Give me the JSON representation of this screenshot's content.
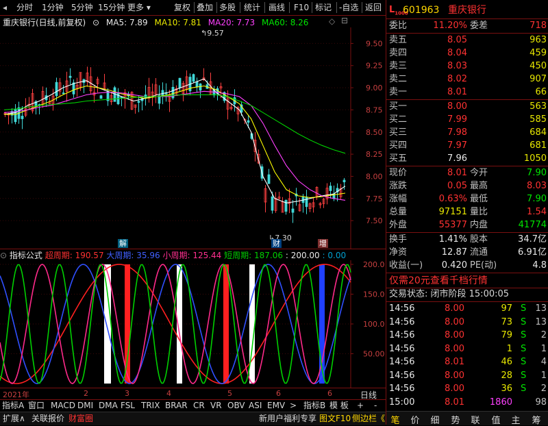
{
  "toolbar": {
    "items": [
      "分时",
      "1分钟",
      "5分钟",
      "15分钟",
      "更多"
    ],
    "items_right": [
      "复权",
      "叠加",
      "多股",
      "统计",
      "画线",
      "F10",
      "标记",
      "-自选",
      "返回"
    ]
  },
  "chart": {
    "title": "重庆银行(日线,前复权)",
    "ma5": "MA5: 7.89",
    "ma10": "MA10: 7.81",
    "ma20": "MA20: 7.73",
    "ma60": "MA60: 8.26",
    "yaxis": [
      "9.50",
      "9.25",
      "9.00",
      "8.75",
      "8.50",
      "8.25",
      "8.00",
      "7.75",
      "7.50"
    ],
    "high_mark": "9.57",
    "low_mark": "7.30",
    "badges": [
      "解",
      "财",
      "增"
    ]
  },
  "chart_data": {
    "type": "line",
    "title": "重庆银行(日线,前复权)",
    "xlabel": "",
    "ylabel": "",
    "ylim": [
      7.3,
      9.6
    ],
    "x": [
      1,
      2,
      3,
      4,
      5,
      6,
      7,
      8,
      9,
      10,
      11,
      12,
      13,
      14,
      15,
      16,
      17,
      18,
      19,
      20,
      21,
      22,
      23,
      24,
      25,
      26,
      27,
      28,
      29,
      30
    ],
    "series": [
      {
        "name": "MA5",
        "values": [
          8.7,
          8.72,
          8.8,
          8.85,
          8.92,
          9.0,
          9.05,
          9.08,
          9.0,
          8.95,
          8.9,
          8.85,
          8.88,
          8.92,
          8.95,
          9.0,
          9.05,
          9.1,
          8.95,
          8.85,
          8.75,
          8.5,
          8.0,
          7.75,
          7.7,
          7.72,
          7.75,
          7.78,
          7.8,
          7.89
        ]
      },
      {
        "name": "MA10",
        "values": [
          8.7,
          8.7,
          8.75,
          8.8,
          8.85,
          8.92,
          8.98,
          9.02,
          9.0,
          8.97,
          8.93,
          8.9,
          8.88,
          8.9,
          8.92,
          8.96,
          9.0,
          9.02,
          8.98,
          8.9,
          8.82,
          8.65,
          8.35,
          8.05,
          7.85,
          7.78,
          7.76,
          7.77,
          7.79,
          7.81
        ]
      },
      {
        "name": "MA20",
        "values": [
          8.72,
          8.73,
          8.75,
          8.78,
          8.8,
          8.84,
          8.88,
          8.92,
          8.94,
          8.95,
          8.94,
          8.92,
          8.9,
          8.9,
          8.9,
          8.92,
          8.94,
          8.96,
          8.95,
          8.93,
          8.9,
          8.8,
          8.6,
          8.35,
          8.12,
          7.95,
          7.85,
          7.78,
          7.75,
          7.73
        ]
      },
      {
        "name": "MA60",
        "values": [
          8.75,
          8.76,
          8.78,
          8.8,
          8.81,
          8.82,
          8.83,
          8.85,
          8.86,
          8.87,
          8.88,
          8.89,
          8.9,
          8.9,
          8.91,
          8.92,
          8.92,
          8.92,
          8.92,
          8.9,
          8.85,
          8.8,
          8.72,
          8.64,
          8.56,
          8.48,
          8.41,
          8.35,
          8.3,
          8.26
        ]
      }
    ]
  },
  "indicator": {
    "label": "指标公式",
    "super": "超周期: 190.57",
    "big": "大周期: 35.96",
    "small": "小周期: 125.44",
    "short": "短周期: 187.06",
    "v200": ": 200.00",
    "v0": ": 0.00",
    "yaxis": [
      "200.0",
      "150.0",
      "100.0",
      "50.00"
    ]
  },
  "timeline": {
    "year": "2021年",
    "months": [
      "2",
      "3",
      "4",
      "5",
      "6"
    ],
    "period": "日线"
  },
  "bottom_tabs": [
    "指标A",
    "窗口",
    "MACD",
    "DMI",
    "DMA",
    "FSL",
    "TRIX",
    "BRAR",
    "CR",
    "VR",
    "OBV",
    "ASI",
    "EMV",
    ">",
    "指标B",
    "模 板",
    "+",
    "-"
  ],
  "status": {
    "left": [
      "扩展∧",
      "关联报价",
      "财富圈"
    ],
    "right": [
      "新用户福利专享",
      "图文F10",
      "侧边栏《"
    ]
  },
  "quote": {
    "code": "601963",
    "name": "重庆银行",
    "weibi_label": "委比",
    "weibi": "11.20%",
    "weicha_label": "委差",
    "weicha": "718",
    "asks": [
      {
        "label": "卖五",
        "price": "8.05",
        "vol": "963"
      },
      {
        "label": "卖四",
        "price": "8.04",
        "vol": "459"
      },
      {
        "label": "卖三",
        "price": "8.03",
        "vol": "450"
      },
      {
        "label": "卖二",
        "price": "8.02",
        "vol": "907"
      },
      {
        "label": "卖一",
        "price": "8.01",
        "vol": "66"
      }
    ],
    "bids": [
      {
        "label": "买一",
        "price": "8.00",
        "vol": "563"
      },
      {
        "label": "买二",
        "price": "7.99",
        "vol": "585"
      },
      {
        "label": "买三",
        "price": "7.98",
        "vol": "684"
      },
      {
        "label": "买四",
        "price": "7.97",
        "vol": "681"
      },
      {
        "label": "买五",
        "price": "7.96",
        "vol": "1050"
      }
    ],
    "stats": [
      {
        "l1": "现价",
        "v1": "8.01",
        "l2": "今开",
        "v2": "7.90"
      },
      {
        "l1": "涨跌",
        "v1": "0.05",
        "l2": "最高",
        "v2": "8.03"
      },
      {
        "l1": "涨幅",
        "v1": "0.63%",
        "l2": "最低",
        "v2": "7.90"
      },
      {
        "l1": "总量",
        "v1": "97151",
        "l2": "量比",
        "v2": "1.54"
      },
      {
        "l1": "外盘",
        "v1": "55377",
        "l2": "内盘",
        "v2": "41774"
      }
    ],
    "stats2": [
      {
        "l1": "换手",
        "v1": "1.41%",
        "l2": "股本",
        "v2": "34.7亿"
      },
      {
        "l1": "净资",
        "v1": "12.87",
        "l2": "流通",
        "v2": "6.91亿"
      },
      {
        "l1": "收益(一)",
        "v1": "0.420",
        "l2": "PE(动)",
        "v2": "4.8"
      }
    ],
    "promo": "仅需20元查看千档行情",
    "trade_status": "交易状态: 闭市阶段 15:00:05",
    "ticks": [
      {
        "t": "14:56",
        "p": "8.00",
        "v": "97",
        "d": "S",
        "n": "13"
      },
      {
        "t": "14:56",
        "p": "8.00",
        "v": "73",
        "d": "S",
        "n": "13"
      },
      {
        "t": "14:56",
        "p": "8.00",
        "v": "79",
        "d": "S",
        "n": "2"
      },
      {
        "t": "14:56",
        "p": "8.00",
        "v": "1",
        "d": "S",
        "n": "1"
      },
      {
        "t": "14:56",
        "p": "8.01",
        "v": "46",
        "d": "S",
        "n": "4"
      },
      {
        "t": "14:56",
        "p": "8.00",
        "v": "28",
        "d": "S",
        "n": "1"
      },
      {
        "t": "14:56",
        "p": "8.00",
        "v": "36",
        "d": "S",
        "n": "2"
      },
      {
        "t": "15:00",
        "p": "8.01",
        "v": "1860",
        "d": "",
        "n": "98"
      }
    ],
    "bottom_tabs": [
      "笔",
      "价",
      "细",
      "势",
      "联",
      "值",
      "主",
      "筹"
    ]
  }
}
